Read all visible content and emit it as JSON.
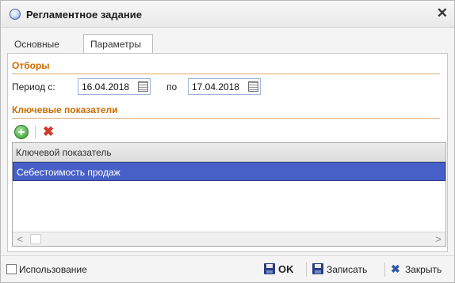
{
  "window": {
    "title": "Регламентное задание",
    "close_symbol": "✕"
  },
  "tabs": [
    {
      "label": "Основные",
      "active": false
    },
    {
      "label": "Параметры",
      "active": true
    }
  ],
  "filters": {
    "section_title": "Отборы",
    "period_from_label": "Период с:",
    "period_from": "16.04.2018",
    "period_to_label": "по",
    "period_to": "17.04.2018"
  },
  "indicators": {
    "section_title": "Ключевые показатели",
    "add_symbol": "",
    "delete_symbol": "✖",
    "column_header": "Ключевой показатель",
    "rows": [
      "Себестоимость продаж"
    ],
    "scroll_left": "<",
    "scroll_right": ">"
  },
  "footer": {
    "use_label": "Использование",
    "use_checked": false,
    "ok_label": "OK",
    "save_label": "Записать",
    "close_label": "Закрыть",
    "close_symbol": "✖"
  },
  "colors": {
    "section_accent": "#c86c00",
    "selection": "#4760c8"
  }
}
